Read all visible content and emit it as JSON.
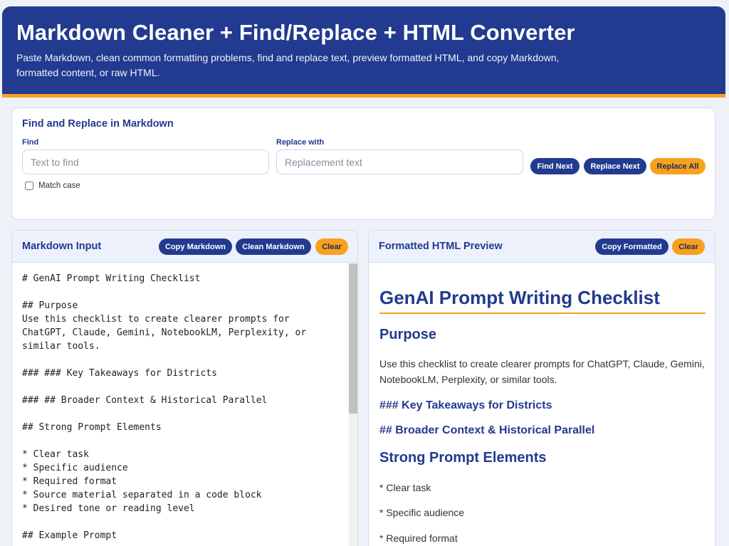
{
  "header": {
    "title": "Markdown Cleaner + Find/Replace + HTML Converter",
    "description": "Paste Markdown, clean common formatting problems, find and replace text, preview formatted HTML, and copy Markdown, formatted content, or raw HTML."
  },
  "find_replace": {
    "title": "Find and Replace in Markdown",
    "find_label": "Find",
    "find_placeholder": "Text to find",
    "find_value": "",
    "replace_label": "Replace with",
    "replace_placeholder": "Replacement text",
    "replace_value": "",
    "find_next_label": "Find Next",
    "replace_next_label": "Replace Next",
    "replace_all_label": "Replace All",
    "match_case_label": "Match case",
    "match_case_checked": false
  },
  "markdown_panel": {
    "title": "Markdown Input",
    "copy_label": "Copy Markdown",
    "clean_label": "Clean Markdown",
    "clear_label": "Clear",
    "content": "# GenAI Prompt Writing Checklist\n\n## Purpose\nUse this checklist to create clearer prompts for\nChatGPT, Claude, Gemini, NotebookLM, Perplexity, or\nsimilar tools.\n\n### ### Key Takeaways for Districts\n\n### ## Broader Context & Historical Parallel\n\n## Strong Prompt Elements\n\n* Clear task\n* Specific audience\n* Required format\n* Source material separated in a code block\n* Desired tone or reading level\n\n## Example Prompt"
  },
  "preview_panel": {
    "title": "Formatted HTML Preview",
    "copy_label": "Copy Formatted",
    "clear_label": "Clear",
    "h1": "GenAI Prompt Writing Checklist",
    "purpose_heading": "Purpose",
    "purpose_text": "Use this checklist to create clearer prompts for ChatGPT, Claude, Gemini, NotebookLM, Perplexity, or similar tools.",
    "heading_takeaways": "### Key Takeaways for Districts",
    "heading_context": "## Broader Context & Historical Parallel",
    "elements_heading": "Strong Prompt Elements",
    "item_1": "* Clear task",
    "item_2": "* Specific audience",
    "item_3": "* Required format"
  },
  "colors": {
    "primary": "#223a8f",
    "accent": "#f7a11f"
  }
}
